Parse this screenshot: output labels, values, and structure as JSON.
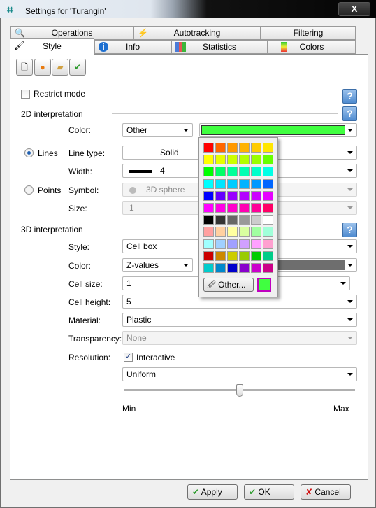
{
  "window": {
    "title": "Settings for 'Turangin'",
    "close_label": "X"
  },
  "tabs_row1": [
    {
      "label": "Operations",
      "icon": "magnifier-folder-icon"
    },
    {
      "label": "Autotracking",
      "icon": "lightning-icon"
    },
    {
      "label": "Filtering",
      "icon": ""
    }
  ],
  "tabs_row2": [
    {
      "label": "Style",
      "icon": "paintbrush-icon",
      "active": true
    },
    {
      "label": "Info",
      "icon": "info-icon"
    },
    {
      "label": "Statistics",
      "icon": "bar-chart-icon"
    },
    {
      "label": "Colors",
      "icon": "color-gradient-icon"
    }
  ],
  "toolbar": [
    "new-document-icon",
    "load-icon",
    "open-folder-icon",
    "apply-default-icon"
  ],
  "restrict_mode": {
    "label": "Restrict mode",
    "checked": false
  },
  "help_label": "?",
  "section_2d": {
    "title": "2D interpretation",
    "color_label": "Color:",
    "color_mode": "Other",
    "color_value": "#40ff40",
    "lines_label": "Lines",
    "lines_selected": true,
    "line_type_label": "Line type:",
    "line_type": "Solid",
    "width_label": "Width:",
    "width": "4",
    "points_label": "Points",
    "points_selected": false,
    "symbol_label": "Symbol:",
    "symbol": "3D sphere",
    "size_label": "Size:",
    "size": "1"
  },
  "section_3d": {
    "title": "3D interpretation",
    "style_label": "Style:",
    "style": "Cell box",
    "color_label": "Color:",
    "color_mode": "Z-values",
    "color_value": "#6e6e6e",
    "cell_size_label": "Cell size:",
    "cell_size": "1",
    "cell_height_label": "Cell height:",
    "cell_height": "5",
    "material_label": "Material:",
    "material": "Plastic",
    "transparency_label": "Transparency:",
    "transparency": "None",
    "resolution_label": "Resolution:",
    "interactive_label": "Interactive",
    "interactive_checked": true,
    "resolution_mode": "Uniform",
    "slider_min": "Min",
    "slider_max": "Max",
    "slider_value_fraction": 0.5
  },
  "palette": {
    "colors": [
      [
        "#ff0000",
        "#ff6600",
        "#ff9900",
        "#ffb300",
        "#ffcc00",
        "#ffe600"
      ],
      [
        "#ffff00",
        "#e6ff00",
        "#ccff00",
        "#b3ff00",
        "#99ff00",
        "#66ff00"
      ],
      [
        "#00ff00",
        "#00ff66",
        "#00ff99",
        "#00ffb3",
        "#00ffcc",
        "#00ffe6"
      ],
      [
        "#00ffff",
        "#00e6ff",
        "#00ccff",
        "#00b3ff",
        "#0099ff",
        "#0066ff"
      ],
      [
        "#0000ff",
        "#6600ff",
        "#9900ff",
        "#b300ff",
        "#cc00ff",
        "#e600ff"
      ],
      [
        "#ff00ff",
        "#ff00e6",
        "#ff00cc",
        "#ff00b3",
        "#ff0099",
        "#ff0066"
      ],
      [
        "#000000",
        "#333333",
        "#666666",
        "#999999",
        "#cccccc",
        "#ffffff"
      ],
      [
        "#ffa0a0",
        "#ffd0a0",
        "#ffffa0",
        "#d9ffa0",
        "#a0ffa0",
        "#a0ffd9"
      ],
      [
        "#a0ffff",
        "#a0d0ff",
        "#a0a0ff",
        "#d0a0ff",
        "#ffa0ff",
        "#ffa0d0"
      ],
      [
        "#cc0000",
        "#cc8800",
        "#cccc00",
        "#99cc00",
        "#00cc00",
        "#00cc88"
      ],
      [
        "#00cccc",
        "#0088cc",
        "#0000cc",
        "#8800cc",
        "#cc00cc",
        "#cc0088"
      ]
    ],
    "other_label": "Other...",
    "current": "#40ff40"
  },
  "buttons": {
    "apply": "Apply",
    "ok": "OK",
    "cancel": "Cancel"
  }
}
